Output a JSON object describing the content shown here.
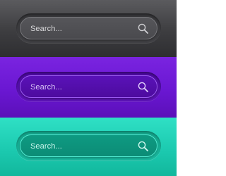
{
  "search_bars": [
    {
      "theme": "gray",
      "placeholder": "Search...",
      "icon": "magnifier-icon",
      "background": "#3d3d40",
      "text_color": "#d8d8da"
    },
    {
      "theme": "purple",
      "placeholder": "Search...",
      "icon": "magnifier-icon",
      "background": "#6a17d2",
      "text_color": "#d9c6f6"
    },
    {
      "theme": "teal",
      "placeholder": "Search...",
      "icon": "magnifier-icon",
      "background": "#1ccab0",
      "text_color": "#c9f5ec"
    }
  ]
}
